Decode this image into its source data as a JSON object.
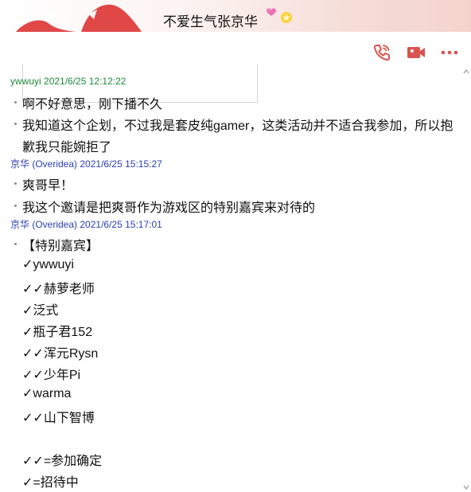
{
  "header": {
    "contact_name": "不爱生气张京华",
    "heart_icon": "pink-sparkle-heart-icon",
    "badge_icon": "star-badge-icon"
  },
  "toolbar": {
    "call_icon": "phone-icon",
    "video_icon": "video-camera-icon",
    "more_icon": "more-dots-icon",
    "accent_color": "#d9534f"
  },
  "messages": [
    {
      "sender": "ywwuyi",
      "time": "2021/6/25 12:12:22",
      "lines": [
        "啊不好意思，刚下播不久",
        "我知道这个企划，不过我是套皮纯gamer，这类活动并不适合我参加，所以抱",
        "歉我只能婉拒了"
      ]
    },
    {
      "sender": "京华 (Overidea)",
      "time": "2021/6/25 15:15:27",
      "lines": [
        "爽哥早！",
        "我这个邀请是把爽哥作为游戏区的特别嘉宾来对待的"
      ]
    },
    {
      "sender": "京华 (Overidea)",
      "time": "2021/6/25 15:17:01",
      "lines": [
        "【特别嘉宾】",
        "✓ywwuyi",
        "✓✓赫萝老师",
        "✓泛式",
        "✓瓶子君152",
        "✓✓浑元Rysn",
        "✓✓少年Pi",
        "✓warma",
        "✓✓山下智博",
        "",
        "✓✓=参加确定",
        "✓=招待中"
      ]
    }
  ],
  "colors": {
    "other_sender": "#1d8a3a",
    "self_sender": "#2a3fb3",
    "header_gradient_end": "#f3d4cd"
  }
}
